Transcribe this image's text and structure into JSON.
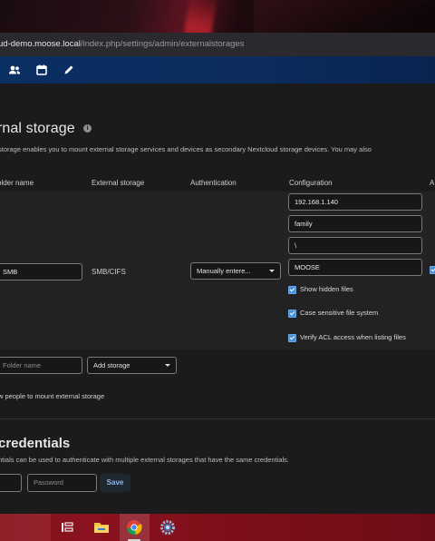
{
  "browser": {
    "url_main": "ud-demo.moose.local",
    "url_path": "/index.php/settings/admin/externalstorages"
  },
  "navbar": {
    "icons": [
      "contacts-icon",
      "calendar-icon",
      "notes-pencil-icon"
    ]
  },
  "page": {
    "title": "rnal storage",
    "description": "storage enables you to mount external storage services and devices as secondary Nextcloud storage devices. You may also"
  },
  "table": {
    "headers": {
      "folder_name": "older name",
      "external_storage": "External storage",
      "authentication": "Authentication",
      "configuration": "Configuration",
      "extra": "A"
    },
    "row": {
      "folder_name": "SMB",
      "external_storage": "SMB/CIFS",
      "authentication": "Manually entere...",
      "config_host": "192.168.1.140",
      "config_share": "family",
      "config_root": "\\",
      "config_domain": "MOOSE",
      "options": [
        {
          "label": "Show hidden files",
          "checked": true
        },
        {
          "label": "Case sensitive file system",
          "checked": true
        },
        {
          "label": "Verify ACL access when listing files",
          "checked": true
        }
      ]
    },
    "new_row": {
      "folder_placeholder": "Folder name",
      "add_storage": "Add storage"
    }
  },
  "allow_users_text": "w people to mount external storage",
  "credentials": {
    "title": "credentials",
    "description": "ntials can be used to authenticate with multiple external storages that have the same credentials.",
    "password_placeholder": "Password",
    "save_label": "Save"
  },
  "taskbar": {
    "icons": [
      "task-view-icon",
      "file-explorer-icon",
      "chrome-icon",
      "settings-icon"
    ]
  },
  "colors": {
    "navbar": "#0b2c5c",
    "accent": "#4a90d9",
    "taskbar": "#8c1220"
  }
}
